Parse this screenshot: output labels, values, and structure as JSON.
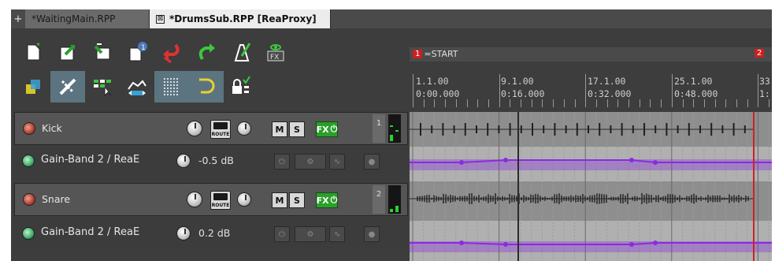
{
  "tabs": [
    {
      "label": "*WaitingMain.RPP",
      "active": false
    },
    {
      "label": "*DrumsSub.RPP [ReaProxy]",
      "active": true
    }
  ],
  "tab_plus": "+",
  "tab_close": "⊠",
  "toolbar": {
    "row1": [
      "new-project-icon",
      "open-project-icon",
      "save-project-icon",
      "project-info-icon",
      "undo-icon",
      "redo-icon",
      "metronome-icon",
      "fx-visibility-icon"
    ],
    "row2": [
      "grid-snap-icon",
      "ripple-edit-icon",
      "item-grouping-icon",
      "envelope-points-icon",
      "grid-lines-icon",
      "loop-icon",
      "lock-icon"
    ],
    "fx_label": "FX"
  },
  "markers": [
    {
      "num": "1",
      "label": "=START"
    },
    {
      "num": "2",
      "label": ""
    }
  ],
  "ruler": [
    {
      "bar": "1.1.00",
      "time": "0:00.000"
    },
    {
      "bar": "9.1.00",
      "time": "0:16.000"
    },
    {
      "bar": "17.1.00",
      "time": "0:32.000"
    },
    {
      "bar": "25.1.00",
      "time": "0:48.000"
    },
    {
      "bar": "33",
      "time": "1:"
    }
  ],
  "tracks": [
    {
      "name": "Kick",
      "number": "1",
      "route": "ROUTE",
      "mute": "M",
      "solo": "S",
      "fx": "FX",
      "envelope": {
        "name": "Gain-Band 2 / ReaE",
        "value": "-0.5 dB"
      }
    },
    {
      "name": "Snare",
      "number": "2",
      "route": "ROUTE",
      "mute": "M",
      "solo": "S",
      "fx": "FX",
      "envelope": {
        "name": "Gain-Band 2 / ReaE",
        "value": "0.2 dB"
      }
    }
  ],
  "colors": {
    "fx_button": "#2aa02a",
    "record_arm": "#b04030",
    "envelope_arm": "#3fae6a",
    "envelope_line": "#8a2be2",
    "marker": "#cc2020",
    "meter": "#2fcf2f"
  }
}
